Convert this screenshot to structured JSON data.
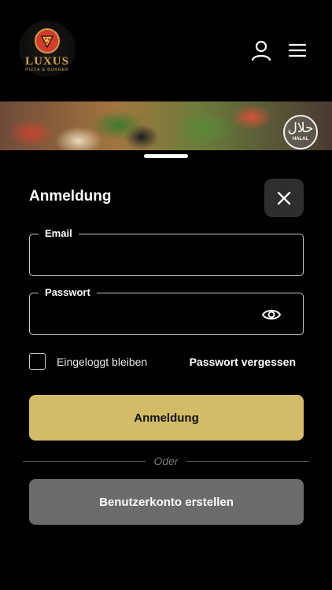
{
  "header": {
    "logo_text": "LUXUS",
    "logo_sub": "PIZZA & BURGER",
    "user_icon": "user-icon",
    "menu_icon": "hamburger-menu-icon"
  },
  "banner": {
    "halal_glyph": "حلال",
    "halal_label": "HALAL"
  },
  "login": {
    "title": "Anmeldung",
    "email_label": "Email",
    "email_value": "",
    "password_label": "Passwort",
    "password_value": "",
    "remember_label": "Eingeloggt bleiben",
    "forgot_label": "Passwort vergessen",
    "submit_label": "Anmeldung",
    "divider_text": "Oder",
    "register_label": "Benutzerkonto erstellen"
  },
  "colors": {
    "background": "#000000",
    "accent": "#d2bc67",
    "secondary_button": "#6b6b6b",
    "close_button": "#2e2e30"
  }
}
